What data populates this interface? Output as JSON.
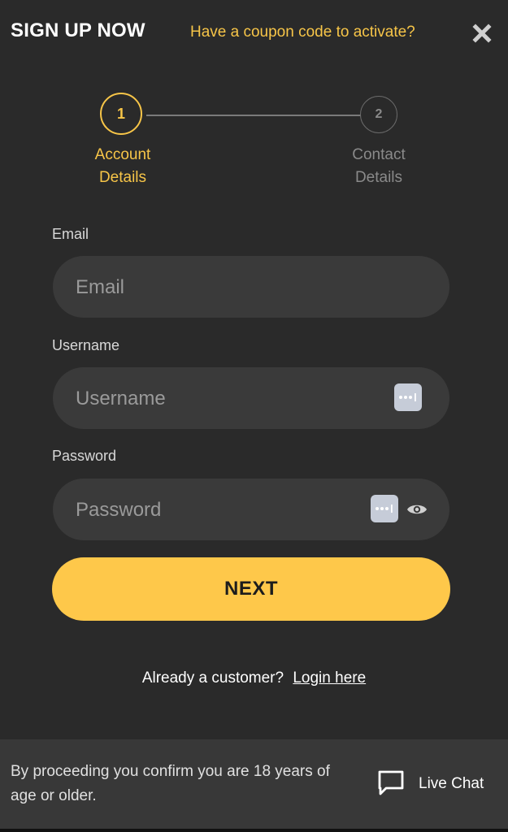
{
  "header": {
    "title": "SIGN UP NOW",
    "coupon_link": "Have a coupon code to activate?",
    "close_icon": "close-icon"
  },
  "stepper": {
    "steps": [
      {
        "number": "1",
        "label_line1": "Account",
        "label_line2": "Details",
        "state": "active"
      },
      {
        "number": "2",
        "label_line1": "Contact",
        "label_line2": "Details",
        "state": "inactive"
      }
    ]
  },
  "form": {
    "email": {
      "label": "Email",
      "placeholder": "Email",
      "value": ""
    },
    "username": {
      "label": "Username",
      "placeholder": "Username",
      "value": ""
    },
    "password": {
      "label": "Password",
      "placeholder": "Password",
      "value": ""
    },
    "next_button": "NEXT"
  },
  "login": {
    "prompt": "Already a customer?",
    "link": "Login here"
  },
  "footer": {
    "age_notice": "By proceeding you confirm you are 18 years of age or older.",
    "live_chat_label": "Live Chat",
    "live_chat_icon": "chat-bubble-icon"
  },
  "colors": {
    "accent": "#fec84a",
    "accent_text": "#f7c548",
    "background": "#2a2a2a",
    "field": "#3a3a3a",
    "footer": "#383838"
  }
}
